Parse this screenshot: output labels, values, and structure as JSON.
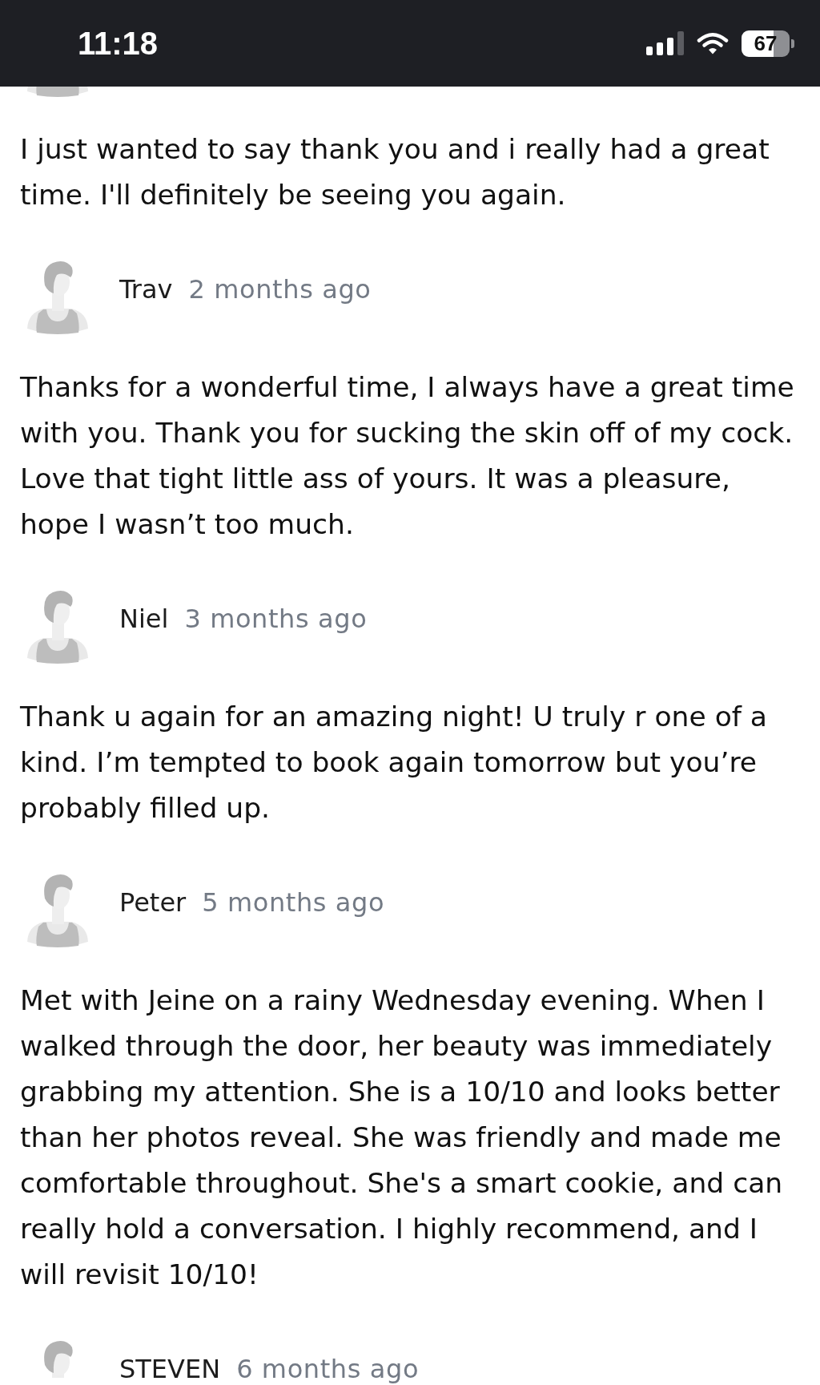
{
  "status_bar": {
    "time": "11:18",
    "battery": "67"
  },
  "reviews": [
    {
      "text": "I just wanted to say thank you and i really had a great time. I'll definitely be seeing you again."
    },
    {
      "name": "Trav",
      "time": "2 months ago",
      "text": "Thanks for a wonderful time, I always have a great time with you. Thank you for sucking the skin off of my cock. Love that tight little ass of yours. It was a pleasure, hope I wasn’t too much."
    },
    {
      "name": "Niel",
      "time": "3 months ago",
      "text": "Thank u again for an amazing night! U truly r one of a kind. I’m tempted to book again tomorrow but you’re probably filled up."
    },
    {
      "name": "Peter",
      "time": "5 months ago",
      "text": "Met with Jeine on a rainy Wednesday evening. When I walked through the door, her beauty was immediately grabbing my attention. She is a 10/10 and looks better than her photos reveal. She was friendly and made me comfortable throughout. She's a smart cookie, and can really hold a conversation. I highly recommend, and I will revisit 10/10!"
    },
    {
      "name": "STEVEN",
      "time": "6 months ago"
    }
  ]
}
